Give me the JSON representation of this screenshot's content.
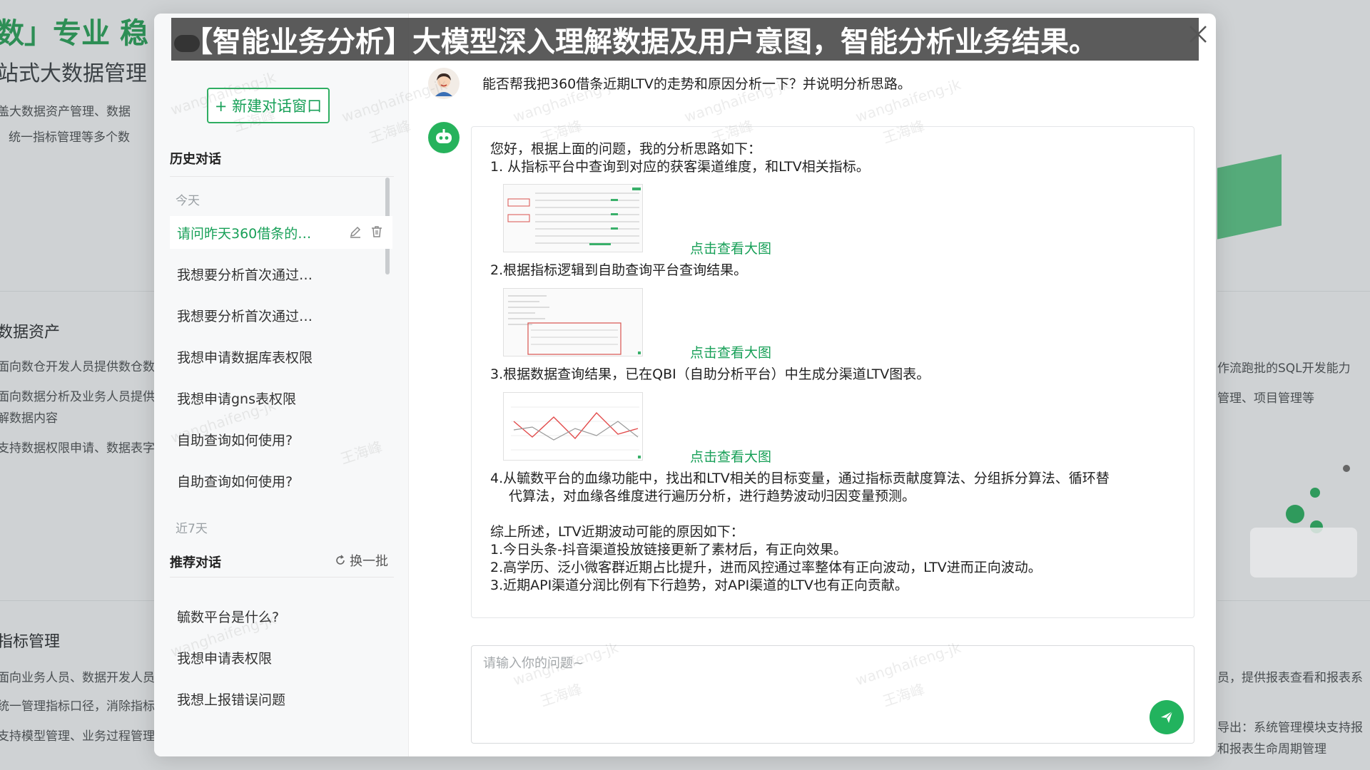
{
  "background": {
    "left_texts": [
      "数」专业 稳",
      "站式大数据管理",
      "盖大数据资产管理、数据",
      "统一指标管理等多个数",
      "数据资产",
      "面向数仓开发人员提供数仓数",
      "面向数据分析及业务人员提供",
      "解数据内容",
      "支持数据权限申请、数据表字",
      "指标管理",
      "面向业务人员、数据开发人员",
      "统一管理指标口径，消除指标",
      "支持模型管理、业务过程管理"
    ],
    "right_texts": [
      "作流跑批的SQL开发能力",
      "管理、项目管理等",
      "员，提供报表查看和报表系",
      "导出：系统管理模块支持报",
      "和报表生命周期管理"
    ]
  },
  "banner": {
    "text": "【智能业务分析】大模型深入理解数据及用户意图，智能分析业务结果。"
  },
  "sidebar": {
    "new_chat_label": "+ 新建对话窗口",
    "history_title": "历史对话",
    "group_today": "今天",
    "group_7days": "近7天",
    "history": [
      "请问昨天360借条的…",
      "我想要分析首次通过…",
      "我想要分析首次通过…",
      "我想申请数据库表权限",
      "我想申请gns表权限",
      "自助查询如何使用?",
      "自助查询如何使用?"
    ],
    "recommend_title": "推荐对话",
    "refresh_label": "换一批",
    "recommend": [
      "毓数平台是什么?",
      "我想申请表权限",
      "我想上报错误问题"
    ]
  },
  "chat": {
    "user_question": "能否帮我把360借条近期LTV的走势和原因分析一下？并说明分析思路。",
    "answer": {
      "intro": "您好，根据上面的问题，我的分析思路如下：",
      "step1": "1. 从指标平台中查询到对应的获客渠道维度，和LTV相关指标。",
      "step2": "2.根据指标逻辑到自助查询平台查询结果。",
      "step3": "3.根据数据查询结果，已在QBI（自助分析平台）中生成分渠道LTV图表。",
      "step4a": "4.从毓数平台的血缘功能中，找出和LTV相关的目标变量，通过指标贡献度算法、分组拆分算法、循环替",
      "step4b": "代算法，对血缘各维度进行遍历分析，进行趋势波动归因变量预测。",
      "summary": "综上所述，LTV近期波动可能的原因如下：",
      "reason1": "1.今日头条-抖音渠道投放链接更新了素材后，有正向效果。",
      "reason2": "2.高学历、泛小微客群近期占比提升，进而风控通过率整体有正向波动，LTV进而正向波动。",
      "reason3": "3.近期API渠道分润比例有下行趋势，对API渠道的LTV也有正向贡献。",
      "view_large": "点击查看大图"
    },
    "input_placeholder": "请输入你的问题~"
  },
  "watermark": {
    "text1": "wanghaifeng-jk",
    "text2": "王海峰"
  },
  "colors": {
    "accent": "#18a058",
    "send": "#22b35e"
  }
}
